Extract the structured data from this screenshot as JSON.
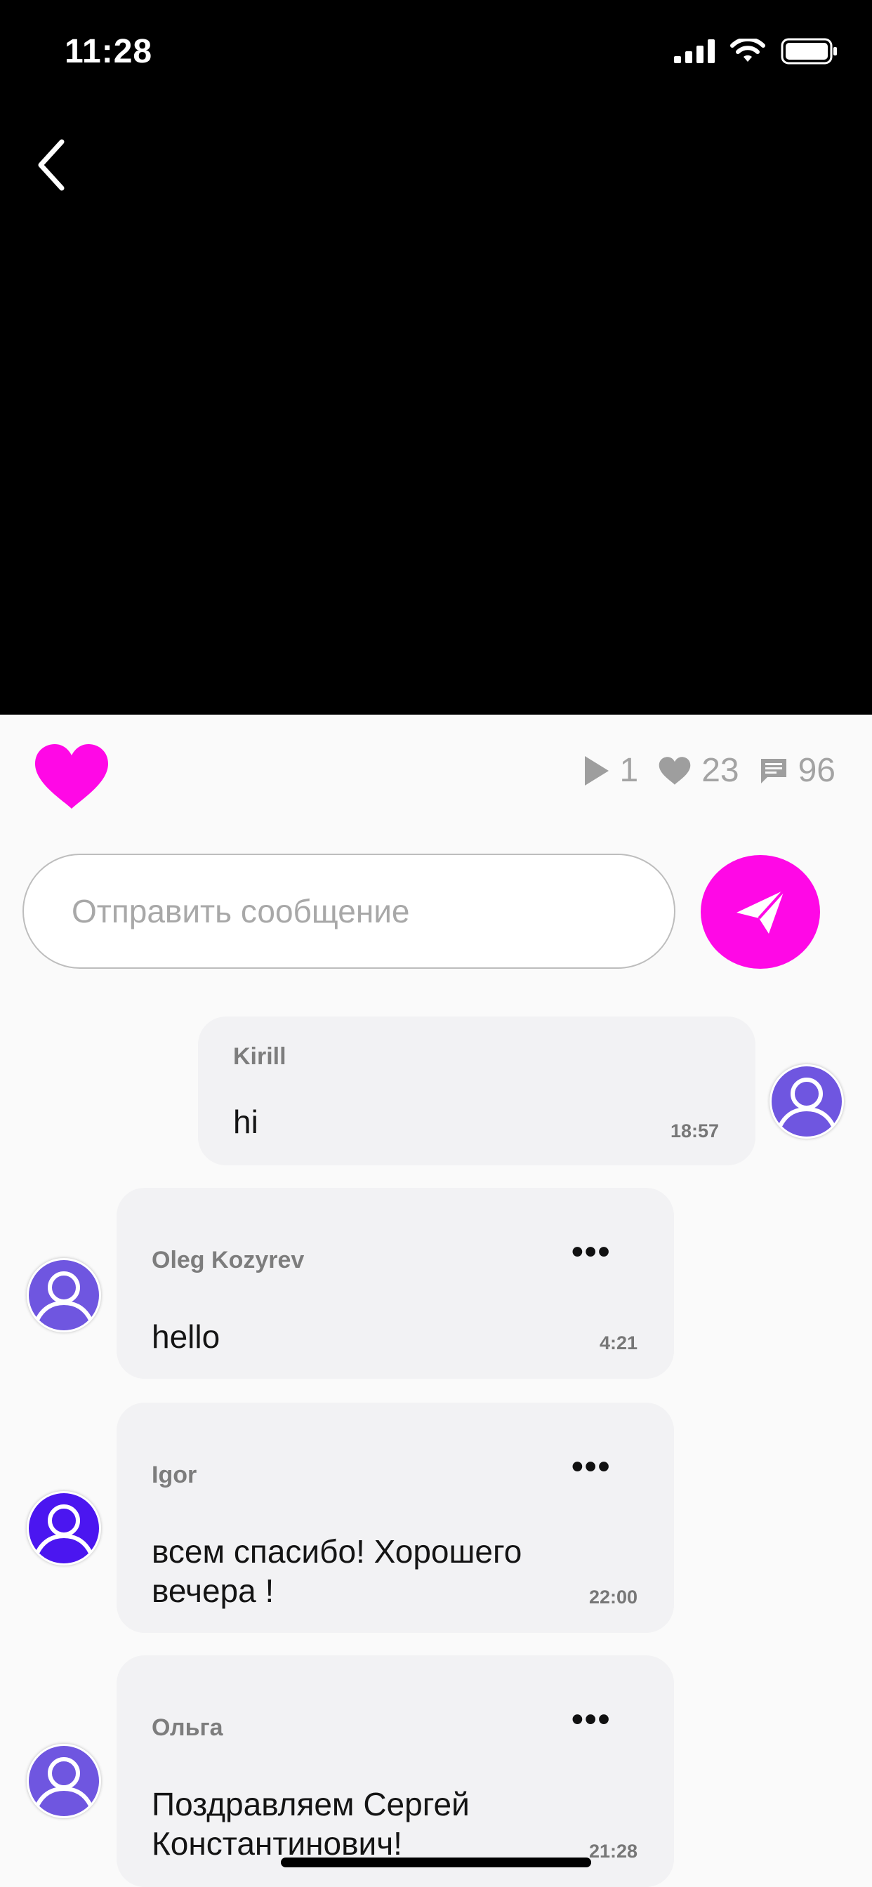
{
  "status_bar": {
    "time": "11:28"
  },
  "stats": {
    "plays": "1",
    "likes": "23",
    "comments": "96"
  },
  "composer": {
    "placeholder": "Отправить сообщение"
  },
  "messages": [
    {
      "author": "Kirill",
      "text": "hi",
      "time": "18:57",
      "avatar_color": "#6f56e0"
    },
    {
      "author": "Oleg Kozyrev",
      "text": "hello",
      "time": "4:21",
      "avatar_color": "#6f56e0"
    },
    {
      "author": "Igor",
      "text": "всем спасибо! Хорошего вечера !",
      "time": "22:00",
      "avatar_color": "#4b16f0"
    },
    {
      "author": "Ольга",
      "text": "Поздравляем Сергей Константинович!",
      "time": "21:28",
      "avatar_color": "#6f56e0"
    }
  ],
  "menu_label": "•••",
  "colors": {
    "accent": "#ff08e6",
    "video_bg": "#000000"
  },
  "icons": [
    "back-icon",
    "heart-icon",
    "play-icon",
    "comment-icon",
    "send-icon",
    "more-icon"
  ]
}
